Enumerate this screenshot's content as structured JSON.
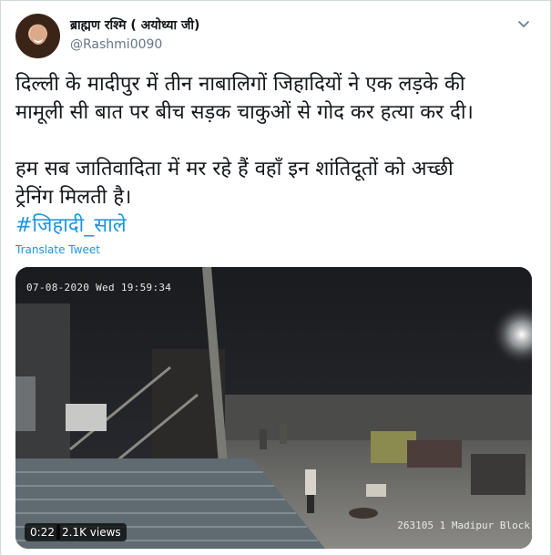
{
  "author": {
    "display_name": "ब्राह्मण रश्मि ( अयोध्या जी)",
    "handle": "@Rashmi0090",
    "avatar_icon": "profile-photo"
  },
  "menu_icon": "chevron-down-icon",
  "tweet": {
    "line1": "दिल्ली के मादीपुर में तीन नाबालिगों जिहादियों ने एक लड़के की",
    "line2": "मामूली सी बात पर बीच सड़क चाकुओं से गोद कर हत्या कर दी।",
    "line3": "हम सब जातिवादिता में मर रहे हैं वहाँ इन शांतिदूतों को अच्छी",
    "line4": "ट्रेनिंग मिलती है।",
    "hashtag": "#जिहादी_साले"
  },
  "translate_label": "Translate Tweet",
  "video": {
    "timestamp_overlay": "07-08-2020 Wed 19:59:34",
    "camera_label": "263105 1 Madipur Block",
    "duration": "0:22",
    "views": "2.1K views"
  },
  "colors": {
    "link": "#1b95e0",
    "text": "#14171a",
    "muted": "#657786"
  }
}
